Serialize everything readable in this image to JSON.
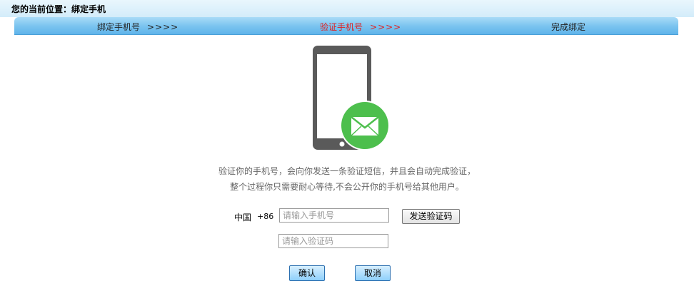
{
  "location": {
    "text": "您的当前位置：绑定手机"
  },
  "steps": [
    {
      "label": "绑定手机号",
      "arrows": ">>>>"
    },
    {
      "label": "验证手机号",
      "arrows": ">>>>"
    },
    {
      "label": "完成绑定"
    }
  ],
  "active_step": "验证手机号",
  "illustration": {
    "icon": "phone-mail-icon",
    "accent_color": "#4dbf4d",
    "phone_color": "#5a5a5a"
  },
  "description": {
    "line1": "验证你的手机号，会向你发送一条验证短信，并且会自动完成验证，",
    "line2": "整个过程你只需要耐心等待,不会公开你的手机号给其他用户。"
  },
  "form": {
    "country": "中国",
    "code": "+86",
    "phone_placeholder": "请输入手机号",
    "send_code_label": "发送验证码",
    "code_placeholder": "请输入验证码"
  },
  "buttons": {
    "confirm": "确认",
    "cancel": "取消"
  }
}
